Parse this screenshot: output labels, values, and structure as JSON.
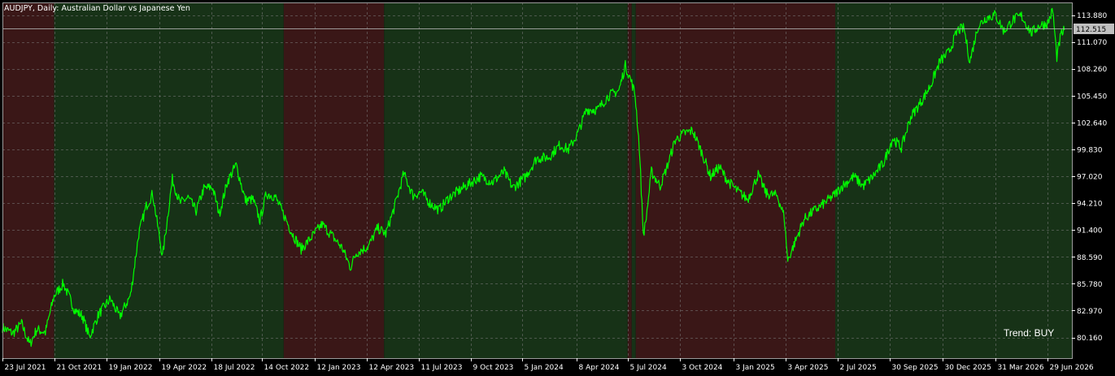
{
  "header": {
    "symbol_info": "AUDJPY, Daily:  Australian Dollar vs Japanese Yen"
  },
  "colors": {
    "background": "#000000",
    "buy_zone": "#173217",
    "sell_zone": "#3a1717",
    "price_line": "#00ff00",
    "grid": "#7a7a7a",
    "axis_text": "#ffffff",
    "bid_label_bg": "#c0c0c0"
  },
  "trend_label": "Trend: BUY",
  "current_price_label": "112.515",
  "chart_data": {
    "type": "line",
    "title": "",
    "xlabel": "",
    "ylabel": "",
    "x_range": [
      "2021-07-23",
      "2026-08-10"
    ],
    "ylim": [
      78.0,
      115.2
    ],
    "y_ticks": [
      "113.880",
      "111.070",
      "108.260",
      "105.450",
      "102.640",
      "99.830",
      "97.020",
      "94.210",
      "91.400",
      "88.590",
      "85.780",
      "82.970",
      "80.160"
    ],
    "x_ticks": [
      "23 Jul 2021",
      "21 Oct 2021",
      "19 Jan 2022",
      "19 Apr 2022",
      "18 Jul 2022",
      "14 Oct 2022",
      "12 Jan 2023",
      "12 Apr 2023",
      "11 Jul 2023",
      "9 Oct 2023",
      "5 Jan 2024",
      "8 Apr 2024",
      "5 Jul 2024",
      "3 Oct 2024",
      "3 Jan 2025",
      "3 Apr 2025",
      "2 Jul 2025",
      "30 Sep 2025",
      "30 Dec 2025",
      "31 Mar 2026",
      "29 Jun 2026"
    ],
    "current_price": 112.515,
    "grid": true,
    "zones": [
      {
        "trend": "sell",
        "start": "2021-07-23",
        "end": "2021-10-20"
      },
      {
        "trend": "buy",
        "start": "2021-10-20",
        "end": "2022-11-20"
      },
      {
        "trend": "sell",
        "start": "2022-11-20",
        "end": "2023-05-12"
      },
      {
        "trend": "buy",
        "start": "2023-05-12",
        "end": "2024-07-05"
      },
      {
        "trend": "sell",
        "start": "2024-07-05",
        "end": "2024-07-12"
      },
      {
        "trend": "buy",
        "start": "2024-07-12",
        "end": "2024-07-19"
      },
      {
        "trend": "sell",
        "start": "2024-07-19",
        "end": "2025-06-28"
      },
      {
        "trend": "buy",
        "start": "2025-06-28",
        "end": "2026-08-10"
      }
    ],
    "series": [
      {
        "x": [
          "2021-07-23",
          "2021-08-10",
          "2021-08-25",
          "2021-09-08",
          "2021-09-20",
          "2021-10-05",
          "2021-10-20",
          "2021-11-05",
          "2021-11-25",
          "2021-12-08",
          "2021-12-20",
          "2022-01-05",
          "2022-01-25",
          "2022-02-10",
          "2022-03-01",
          "2022-03-15",
          "2022-03-28",
          "2022-04-08",
          "2022-04-25",
          "2022-05-12",
          "2022-05-25",
          "2022-06-08",
          "2022-06-22",
          "2022-07-05",
          "2022-07-20",
          "2022-08-01",
          "2022-08-15",
          "2022-08-30",
          "2022-09-15",
          "2022-09-28",
          "2022-10-10",
          "2022-10-21",
          "2022-11-05",
          "2022-11-20",
          "2022-12-05",
          "2022-12-20",
          "2023-01-05",
          "2023-01-25",
          "2023-02-10",
          "2023-03-01",
          "2023-03-15",
          "2023-03-25",
          "2023-04-15",
          "2023-05-01",
          "2023-05-15",
          "2023-05-30",
          "2023-06-15",
          "2023-07-01",
          "2023-07-15",
          "2023-07-30",
          "2023-08-15",
          "2023-09-01",
          "2023-09-20",
          "2023-10-05",
          "2023-10-25",
          "2023-11-15",
          "2023-12-05",
          "2023-12-20",
          "2024-01-10",
          "2024-01-30",
          "2024-02-20",
          "2024-03-10",
          "2024-03-25",
          "2024-04-10",
          "2024-04-25",
          "2024-05-15",
          "2024-06-01",
          "2024-06-20",
          "2024-07-01",
          "2024-07-11",
          "2024-07-18",
          "2024-07-25",
          "2024-08-01",
          "2024-08-05",
          "2024-08-15",
          "2024-08-30",
          "2024-09-11",
          "2024-09-25",
          "2024-10-10",
          "2024-10-25",
          "2024-11-10",
          "2024-11-25",
          "2024-12-10",
          "2024-12-25",
          "2025-01-10",
          "2025-01-28",
          "2025-02-15",
          "2025-03-01",
          "2025-03-20",
          "2025-04-01",
          "2025-04-07",
          "2025-04-20",
          "2025-05-05",
          "2025-05-20",
          "2025-06-05",
          "2025-06-25",
          "2025-07-10",
          "2025-07-30",
          "2025-08-15",
          "2025-09-01",
          "2025-09-20",
          "2025-10-05",
          "2025-10-20",
          "2025-11-05",
          "2025-11-25",
          "2025-12-10",
          "2025-12-25",
          "2026-01-10",
          "2026-01-25",
          "2026-02-05",
          "2026-02-15",
          "2026-03-01",
          "2026-03-15",
          "2026-03-31",
          "2026-04-15",
          "2026-05-01",
          "2026-05-15",
          "2026-06-01",
          "2026-06-15",
          "2026-06-29",
          "2026-07-08",
          "2026-07-15",
          "2026-07-22",
          "2026-07-28"
        ],
        "values": [
          81.2,
          80.6,
          81.6,
          79.4,
          81.0,
          80.7,
          84.5,
          85.8,
          83.0,
          82.4,
          80.2,
          82.6,
          84.2,
          82.3,
          84.6,
          91.0,
          93.9,
          95.2,
          88.6,
          96.7,
          94.2,
          94.8,
          93.4,
          95.7,
          95.9,
          93.1,
          96.5,
          98.2,
          94.5,
          94.6,
          92.4,
          95.2,
          94.9,
          93.0,
          91.0,
          89.4,
          90.5,
          92.0,
          90.9,
          89.5,
          87.5,
          89.0,
          89.7,
          91.6,
          91.0,
          93.8,
          97.3,
          95.0,
          95.4,
          94.2,
          93.5,
          94.8,
          95.6,
          96.2,
          97.0,
          96.4,
          97.5,
          95.8,
          96.9,
          98.9,
          99.0,
          100.3,
          99.8,
          101.5,
          104.0,
          104.0,
          105.4,
          106.0,
          108.6,
          107.0,
          105.5,
          100.2,
          91.0,
          92.1,
          97.5,
          96.0,
          98.0,
          100.8,
          101.5,
          101.8,
          99.5,
          97.0,
          98.0,
          96.5,
          95.5,
          94.6,
          97.2,
          95.2,
          95.0,
          92.8,
          88.2,
          90.2,
          92.5,
          93.3,
          94.0,
          95.0,
          96.0,
          97.0,
          96.0,
          97.0,
          98.5,
          101.0,
          100.0,
          103.2,
          105.0,
          106.6,
          109.0,
          110.0,
          112.3,
          112.5,
          109.0,
          112.7,
          113.6,
          113.9,
          112.2,
          113.4,
          113.8,
          112.0,
          112.8,
          113.0,
          114.4,
          109.5,
          111.8,
          112.3
        ]
      }
    ]
  }
}
